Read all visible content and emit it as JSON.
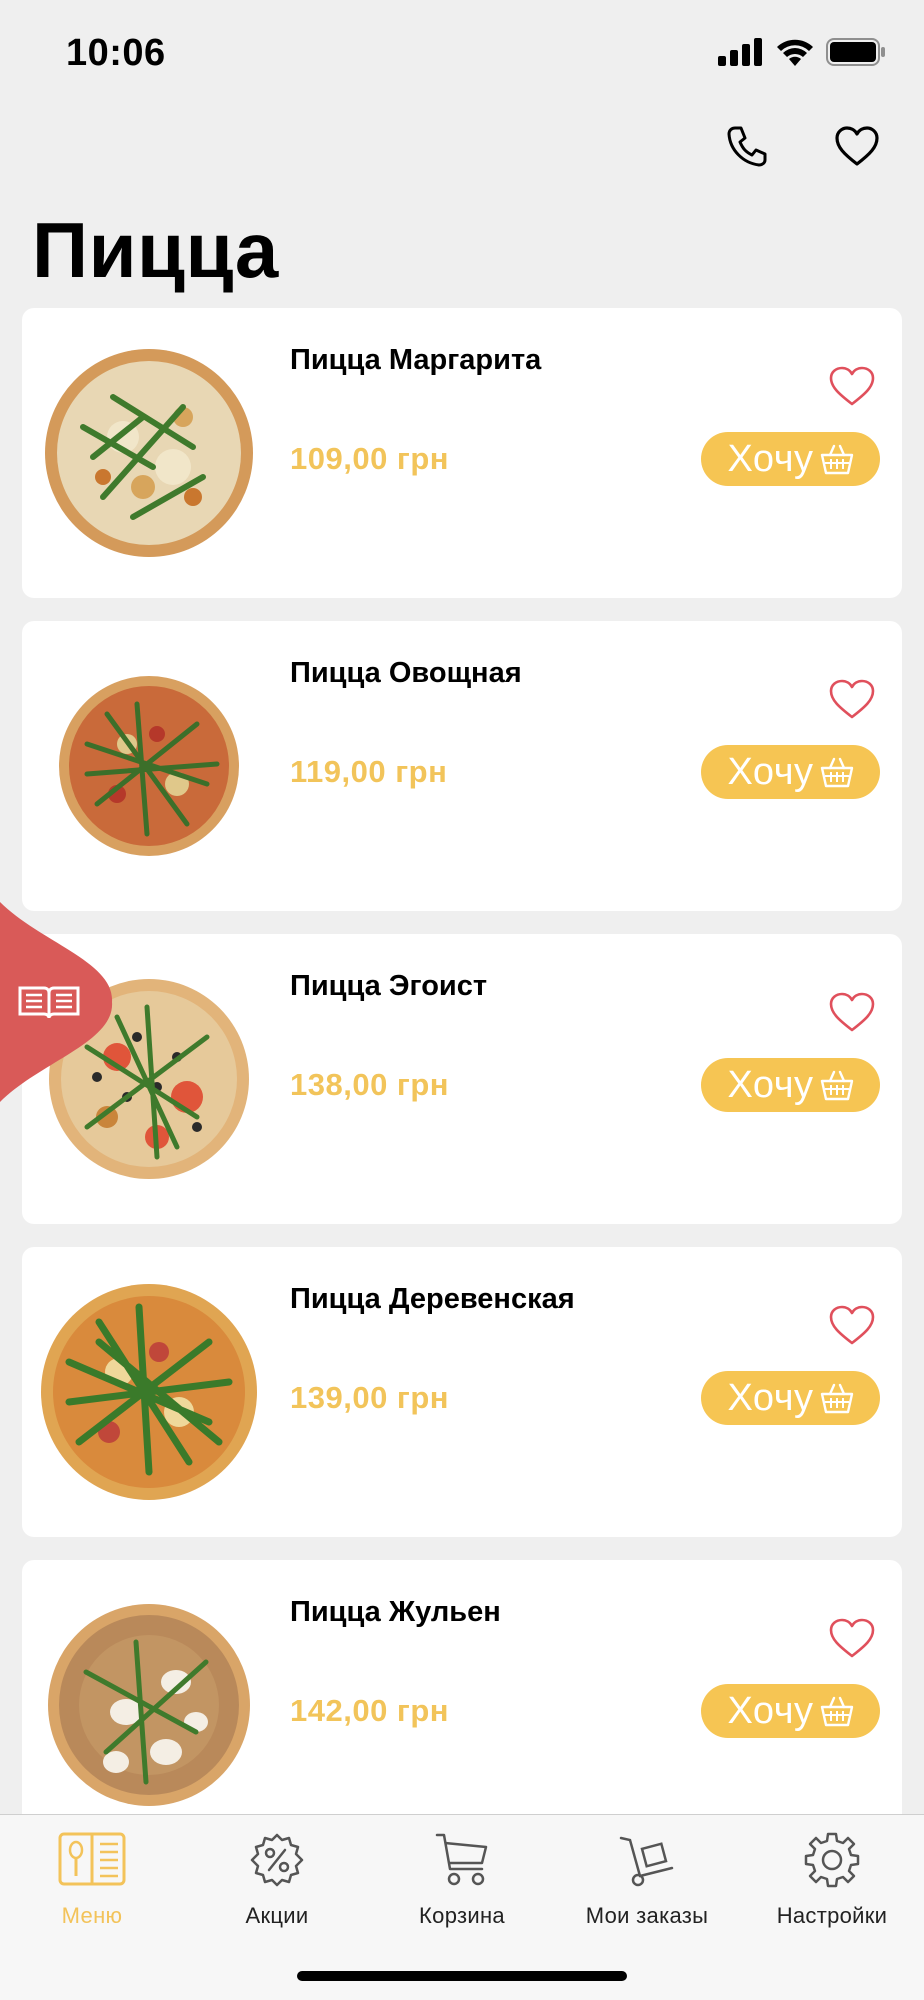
{
  "status_bar": {
    "time": "10:06"
  },
  "page": {
    "title": "Пицца"
  },
  "products": [
    {
      "name": "Пицца Маргарита",
      "price": "109,00 грн",
      "button": "Хочу"
    },
    {
      "name": "Пицца Овощная",
      "price": "119,00 грн",
      "button": "Хочу"
    },
    {
      "name": "Пицца Эгоист",
      "price": "138,00 грн",
      "button": "Хочу"
    },
    {
      "name": "Пицца Деревенская",
      "price": "139,00 грн",
      "button": "Хочу"
    },
    {
      "name": "Пицца Жульен",
      "price": "142,00 грн",
      "button": "Хочу"
    }
  ],
  "bottom_nav": {
    "items": [
      {
        "label": "Меню",
        "icon": "menu-book-icon",
        "active": true
      },
      {
        "label": "Акции",
        "icon": "percent-badge-icon",
        "active": false
      },
      {
        "label": "Корзина",
        "icon": "cart-icon",
        "active": false
      },
      {
        "label": "Мои заказы",
        "icon": "hand-truck-icon",
        "active": false
      },
      {
        "label": "Настройки",
        "icon": "gear-icon",
        "active": false
      }
    ]
  },
  "colors": {
    "accent": "#f6c553",
    "price": "#f2c45a",
    "heart": "#e0505c",
    "side_tab": "#d95a58",
    "background": "#efefef"
  }
}
